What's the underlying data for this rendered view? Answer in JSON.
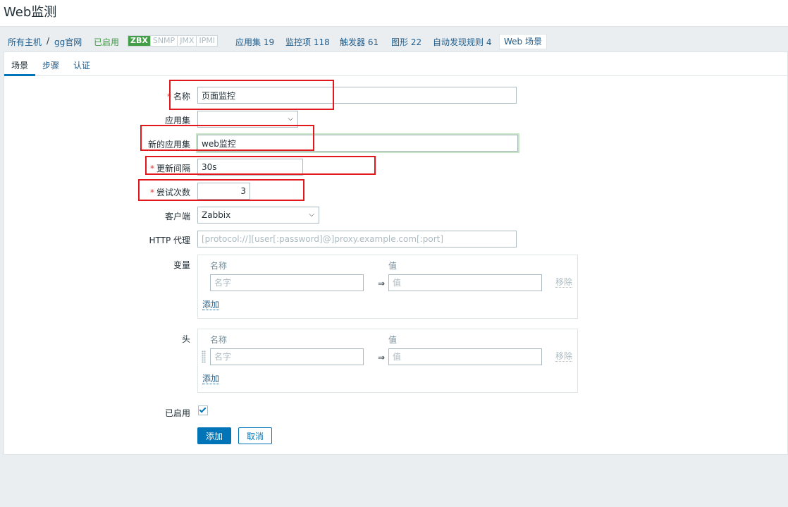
{
  "page": {
    "title": "Web监测"
  },
  "breadcrumb": {
    "all_hosts": "所有主机",
    "separator": "/",
    "host": "gg官网",
    "status": "已启用",
    "availability": [
      "ZBX",
      "SNMP",
      "JMX",
      "IPMI"
    ],
    "applications": "应用集 19",
    "items": "监控项 118",
    "triggers": "触发器 61",
    "graphs": "图形 22",
    "discovery": "自动发现规则 4",
    "web": "Web 场景"
  },
  "tabs": [
    "场景",
    "步骤",
    "认证"
  ],
  "form": {
    "name": {
      "label": "名称",
      "value": "页面监控"
    },
    "application": {
      "label": "应用集",
      "value": ""
    },
    "new_application": {
      "label": "新的应用集",
      "value": "web监控"
    },
    "update_interval": {
      "label": "更新间隔",
      "value": "30s"
    },
    "attempts": {
      "label": "尝试次数",
      "value": "3"
    },
    "agent": {
      "label": "客户端",
      "value": "Zabbix"
    },
    "http_proxy": {
      "label": "HTTP 代理",
      "placeholder": "[protocol://][user[:password]@]proxy.example.com[:port]"
    },
    "variables": {
      "label": "变量",
      "col_name": "名称",
      "col_value": "值",
      "name_placeholder": "名字",
      "value_placeholder": "值",
      "arrow": "⇒",
      "remove": "移除",
      "add": "添加"
    },
    "headers": {
      "label": "头",
      "col_name": "名称",
      "col_value": "值",
      "name_placeholder": "名字",
      "value_placeholder": "值",
      "arrow": "⇒",
      "remove": "移除",
      "add": "添加"
    },
    "enabled": {
      "label": "已启用",
      "checked": true
    },
    "buttons": {
      "add": "添加",
      "cancel": "取消"
    }
  },
  "colors": {
    "accent": "#0275b8",
    "enabled_green": "#429e47",
    "required_red": "#e33734",
    "annotation_red": "#e3181d"
  }
}
